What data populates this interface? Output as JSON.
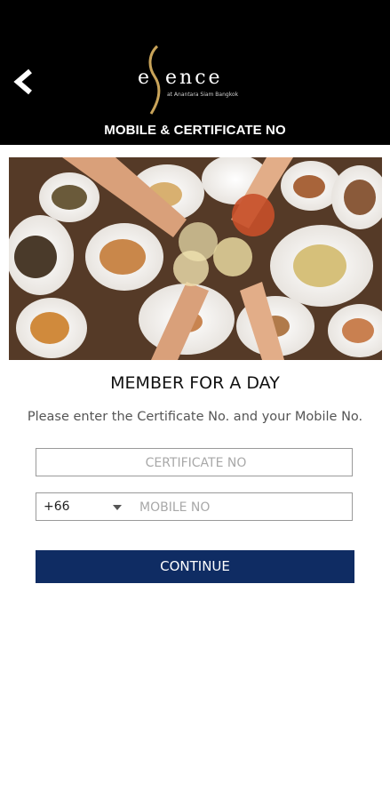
{
  "header": {
    "title": "MOBILE & CERTIFICATE NO",
    "back_icon": "chevron-left-icon"
  },
  "logo": {
    "brand": "essence",
    "subtitle": "at Anantara Siam Bangkok"
  },
  "main": {
    "section_title": "MEMBER FOR A DAY",
    "instructions": "Please enter the Certificate No. and your Mobile No."
  },
  "form": {
    "certificate_placeholder": "CERTIFICATE NO",
    "country_code": "+66",
    "mobile_placeholder": "MOBILE NO",
    "continue_label": "CONTINUE"
  },
  "colors": {
    "header_bg": "#000000",
    "accent_gold": "#c9a45a",
    "button_bg": "#0f2c63"
  }
}
